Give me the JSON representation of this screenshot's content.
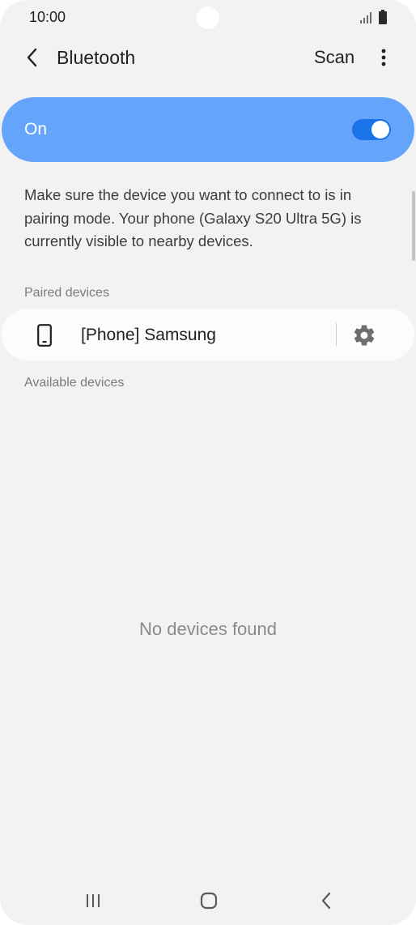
{
  "status_bar": {
    "time": "10:00",
    "icons": [
      "signal-icon",
      "battery-icon"
    ]
  },
  "header": {
    "back_icon": "chevron-left-icon",
    "title": "Bluetooth",
    "scan_label": "Scan",
    "more_icon": "more-vertical-icon"
  },
  "bluetooth_toggle": {
    "label": "On",
    "state": true
  },
  "description": "Make sure the device you want to connect to is in pairing mode. Your phone (Galaxy S20 Ultra 5G) is currently visible to nearby devices.",
  "paired_devices": {
    "header": "Paired devices",
    "items": [
      {
        "name": "[Phone] Samsung",
        "icon": "smartphone-icon",
        "settings_icon": "gear-icon"
      }
    ]
  },
  "available_devices": {
    "header": "Available devices",
    "empty_text": "No devices found"
  },
  "nav_bar": {
    "buttons": [
      "recent-apps-icon",
      "home-icon",
      "back-icon"
    ]
  },
  "colors": {
    "background": "#f2f2f2",
    "toggle_card": "#64a4fb",
    "switch_track": "#1a73e8",
    "card": "#fcfcfc"
  }
}
